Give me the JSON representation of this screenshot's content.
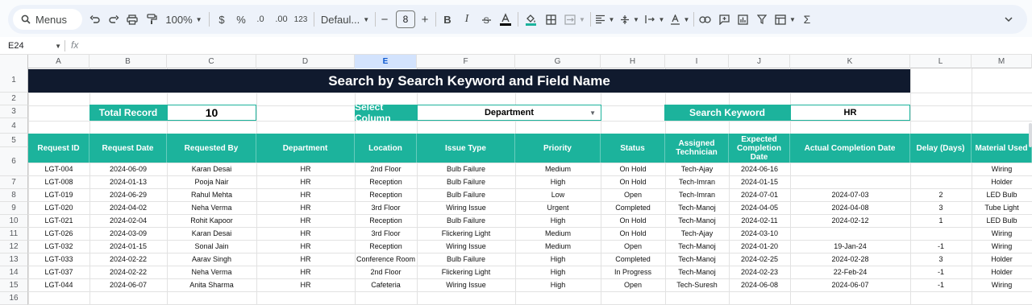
{
  "toolbar": {
    "search_label": "Menus",
    "zoom": "100%",
    "currency": "$",
    "percent": "%",
    "decrease_decimals": ".0",
    "increase_decimals": ".00",
    "number_format": "123",
    "font": "Defaul...",
    "font_size": "8",
    "minus": "−",
    "plus": "+",
    "bold": "B",
    "italic": "I",
    "sum": "Σ"
  },
  "formula_bar": {
    "cell_ref": "E24",
    "fx": "fx"
  },
  "columns": [
    "A",
    "B",
    "C",
    "D",
    "E",
    "F",
    "G",
    "H",
    "I",
    "J",
    "K",
    "L",
    "M"
  ],
  "active_column": "E",
  "rows": [
    "1",
    "2",
    "3",
    "4",
    "5",
    "6",
    "7",
    "8",
    "9",
    "10",
    "11",
    "12",
    "13",
    "14",
    "15",
    "16"
  ],
  "title": "Search by Search Keyword and Field Name",
  "filters": {
    "total_label": "Total Record",
    "total_value": "10",
    "column_label": "Select Column",
    "column_value": "Department",
    "keyword_label": "Search Keyword",
    "keyword_value": "HR"
  },
  "table": {
    "headers": [
      "Request ID",
      "Request Date",
      "Requested By",
      "Department",
      "Location",
      "Issue Type",
      "Priority",
      "Status",
      "Assigned Technician",
      "Expected Completion Date",
      "Actual Completion Date",
      "Delay (Days)",
      "Material Used"
    ],
    "rows": [
      [
        "LGT-004",
        "2024-06-09",
        "Karan Desai",
        "HR",
        "2nd Floor",
        "Bulb Failure",
        "Medium",
        "On Hold",
        "Tech-Ajay",
        "2024-06-16",
        "",
        "",
        "Wiring"
      ],
      [
        "LGT-008",
        "2024-01-13",
        "Pooja Nair",
        "HR",
        "Reception",
        "Bulb Failure",
        "High",
        "On Hold",
        "Tech-Imran",
        "2024-01-15",
        "",
        "",
        "Holder"
      ],
      [
        "LGT-019",
        "2024-06-29",
        "Rahul Mehta",
        "HR",
        "Reception",
        "Bulb Failure",
        "Low",
        "Open",
        "Tech-Imran",
        "2024-07-01",
        "2024-07-03",
        "2",
        "LED Bulb"
      ],
      [
        "LGT-020",
        "2024-04-02",
        "Neha Verma",
        "HR",
        "3rd Floor",
        "Wiring Issue",
        "Urgent",
        "Completed",
        "Tech-Manoj",
        "2024-04-05",
        "2024-04-08",
        "3",
        "Tube Light"
      ],
      [
        "LGT-021",
        "2024-02-04",
        "Rohit Kapoor",
        "HR",
        "Reception",
        "Bulb Failure",
        "High",
        "On Hold",
        "Tech-Manoj",
        "2024-02-11",
        "2024-02-12",
        "1",
        "LED Bulb"
      ],
      [
        "LGT-026",
        "2024-03-09",
        "Karan Desai",
        "HR",
        "3rd Floor",
        "Flickering Light",
        "Medium",
        "On Hold",
        "Tech-Ajay",
        "2024-03-10",
        "",
        "",
        "Wiring"
      ],
      [
        "LGT-032",
        "2024-01-15",
        "Sonal Jain",
        "HR",
        "Reception",
        "Wiring Issue",
        "Medium",
        "Open",
        "Tech-Manoj",
        "2024-01-20",
        "19-Jan-24",
        "-1",
        "Wiring"
      ],
      [
        "LGT-033",
        "2024-02-22",
        "Aarav Singh",
        "HR",
        "Conference Room",
        "Bulb Failure",
        "High",
        "Completed",
        "Tech-Manoj",
        "2024-02-25",
        "2024-02-28",
        "3",
        "Holder"
      ],
      [
        "LGT-037",
        "2024-02-22",
        "Neha Verma",
        "HR",
        "2nd Floor",
        "Flickering Light",
        "High",
        "In Progress",
        "Tech-Manoj",
        "2024-02-23",
        "22-Feb-24",
        "-1",
        "Holder"
      ],
      [
        "LGT-044",
        "2024-06-07",
        "Anita Sharma",
        "HR",
        "Cafeteria",
        "Wiring Issue",
        "High",
        "Open",
        "Tech-Suresh",
        "2024-06-08",
        "2024-06-07",
        "-1",
        "Wiring"
      ]
    ]
  },
  "colors": {
    "header_teal": "#1cb39c",
    "title_navy": "#101a2e"
  }
}
